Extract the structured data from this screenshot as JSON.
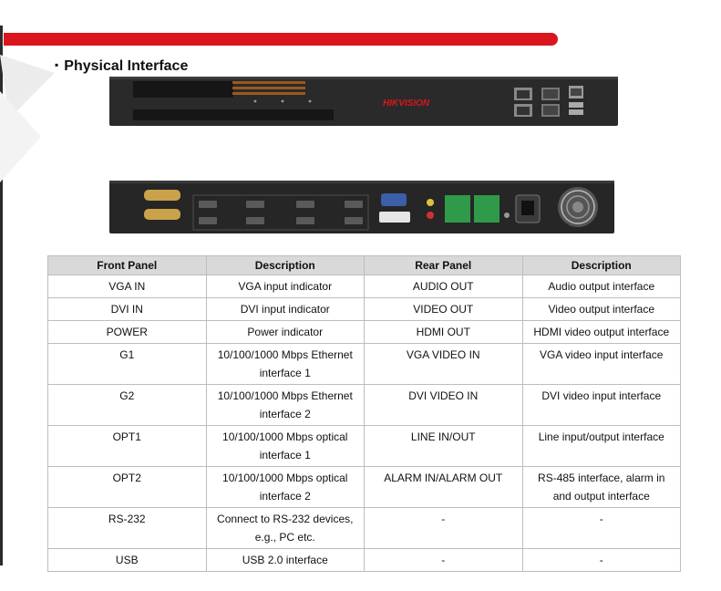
{
  "section": {
    "bullet": "▪",
    "title": "Physical Interface"
  },
  "front_panel": {
    "brand": "HIKVISION",
    "indicators": [
      "VGA IN",
      "DVI IN",
      "POWER"
    ],
    "ports": [
      "G1",
      "G2",
      "OPT1",
      "OPT2",
      "RS-232",
      "USB"
    ]
  },
  "table": {
    "headers": [
      "Front Panel",
      "Description",
      "Rear Panel",
      "Description"
    ],
    "rows": [
      [
        "VGA IN",
        "VGA input indicator",
        "AUDIO OUT",
        "Audio output interface"
      ],
      [
        "DVI IN",
        "DVI input indicator",
        "VIDEO OUT",
        "Video output interface"
      ],
      [
        "POWER",
        "Power indicator",
        "HDMI OUT",
        "HDMI video output interface"
      ],
      [
        "G1",
        "10/100/1000 Mbps Ethernet interface 1",
        "VGA VIDEO IN",
        "VGA video input interface"
      ],
      [
        "G2",
        "10/100/1000 Mbps Ethernet interface 2",
        "DVI VIDEO IN",
        "DVI video input interface"
      ],
      [
        "OPT1",
        "10/100/1000 Mbps optical interface 1",
        "LINE IN/OUT",
        "Line input/output interface"
      ],
      [
        "OPT2",
        "10/100/1000 Mbps optical interface 2",
        "ALARM IN/ALARM OUT",
        "RS-485 interface, alarm in and output interface"
      ],
      [
        "RS-232",
        "Connect to RS-232 devices, e.g., PC etc.",
        "-",
        "-"
      ],
      [
        "USB",
        "USB 2.0 interface",
        "-",
        "-"
      ]
    ]
  },
  "colors": {
    "accent_red": "#d9161d",
    "header_gray": "#d9d9d9",
    "device_body": "#2a2a2a"
  }
}
